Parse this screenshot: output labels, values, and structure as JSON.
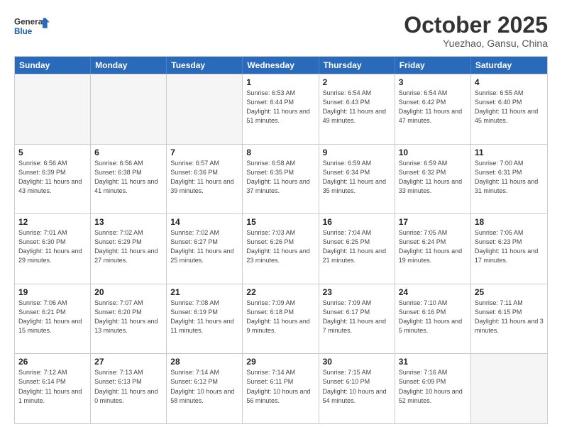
{
  "logo": {
    "line1": "General",
    "line2": "Blue"
  },
  "title": "October 2025",
  "subtitle": "Yuezhao, Gansu, China",
  "days_of_week": [
    "Sunday",
    "Monday",
    "Tuesday",
    "Wednesday",
    "Thursday",
    "Friday",
    "Saturday"
  ],
  "weeks": [
    [
      {
        "num": "",
        "info": ""
      },
      {
        "num": "",
        "info": ""
      },
      {
        "num": "",
        "info": ""
      },
      {
        "num": "1",
        "info": "Sunrise: 6:53 AM\nSunset: 6:44 PM\nDaylight: 11 hours\nand 51 minutes."
      },
      {
        "num": "2",
        "info": "Sunrise: 6:54 AM\nSunset: 6:43 PM\nDaylight: 11 hours\nand 49 minutes."
      },
      {
        "num": "3",
        "info": "Sunrise: 6:54 AM\nSunset: 6:42 PM\nDaylight: 11 hours\nand 47 minutes."
      },
      {
        "num": "4",
        "info": "Sunrise: 6:55 AM\nSunset: 6:40 PM\nDaylight: 11 hours\nand 45 minutes."
      }
    ],
    [
      {
        "num": "5",
        "info": "Sunrise: 6:56 AM\nSunset: 6:39 PM\nDaylight: 11 hours\nand 43 minutes."
      },
      {
        "num": "6",
        "info": "Sunrise: 6:56 AM\nSunset: 6:38 PM\nDaylight: 11 hours\nand 41 minutes."
      },
      {
        "num": "7",
        "info": "Sunrise: 6:57 AM\nSunset: 6:36 PM\nDaylight: 11 hours\nand 39 minutes."
      },
      {
        "num": "8",
        "info": "Sunrise: 6:58 AM\nSunset: 6:35 PM\nDaylight: 11 hours\nand 37 minutes."
      },
      {
        "num": "9",
        "info": "Sunrise: 6:59 AM\nSunset: 6:34 PM\nDaylight: 11 hours\nand 35 minutes."
      },
      {
        "num": "10",
        "info": "Sunrise: 6:59 AM\nSunset: 6:32 PM\nDaylight: 11 hours\nand 33 minutes."
      },
      {
        "num": "11",
        "info": "Sunrise: 7:00 AM\nSunset: 6:31 PM\nDaylight: 11 hours\nand 31 minutes."
      }
    ],
    [
      {
        "num": "12",
        "info": "Sunrise: 7:01 AM\nSunset: 6:30 PM\nDaylight: 11 hours\nand 29 minutes."
      },
      {
        "num": "13",
        "info": "Sunrise: 7:02 AM\nSunset: 6:29 PM\nDaylight: 11 hours\nand 27 minutes."
      },
      {
        "num": "14",
        "info": "Sunrise: 7:02 AM\nSunset: 6:27 PM\nDaylight: 11 hours\nand 25 minutes."
      },
      {
        "num": "15",
        "info": "Sunrise: 7:03 AM\nSunset: 6:26 PM\nDaylight: 11 hours\nand 23 minutes."
      },
      {
        "num": "16",
        "info": "Sunrise: 7:04 AM\nSunset: 6:25 PM\nDaylight: 11 hours\nand 21 minutes."
      },
      {
        "num": "17",
        "info": "Sunrise: 7:05 AM\nSunset: 6:24 PM\nDaylight: 11 hours\nand 19 minutes."
      },
      {
        "num": "18",
        "info": "Sunrise: 7:05 AM\nSunset: 6:23 PM\nDaylight: 11 hours\nand 17 minutes."
      }
    ],
    [
      {
        "num": "19",
        "info": "Sunrise: 7:06 AM\nSunset: 6:21 PM\nDaylight: 11 hours\nand 15 minutes."
      },
      {
        "num": "20",
        "info": "Sunrise: 7:07 AM\nSunset: 6:20 PM\nDaylight: 11 hours\nand 13 minutes."
      },
      {
        "num": "21",
        "info": "Sunrise: 7:08 AM\nSunset: 6:19 PM\nDaylight: 11 hours\nand 11 minutes."
      },
      {
        "num": "22",
        "info": "Sunrise: 7:09 AM\nSunset: 6:18 PM\nDaylight: 11 hours\nand 9 minutes."
      },
      {
        "num": "23",
        "info": "Sunrise: 7:09 AM\nSunset: 6:17 PM\nDaylight: 11 hours\nand 7 minutes."
      },
      {
        "num": "24",
        "info": "Sunrise: 7:10 AM\nSunset: 6:16 PM\nDaylight: 11 hours\nand 5 minutes."
      },
      {
        "num": "25",
        "info": "Sunrise: 7:11 AM\nSunset: 6:15 PM\nDaylight: 11 hours\nand 3 minutes."
      }
    ],
    [
      {
        "num": "26",
        "info": "Sunrise: 7:12 AM\nSunset: 6:14 PM\nDaylight: 11 hours\nand 1 minute."
      },
      {
        "num": "27",
        "info": "Sunrise: 7:13 AM\nSunset: 6:13 PM\nDaylight: 11 hours\nand 0 minutes."
      },
      {
        "num": "28",
        "info": "Sunrise: 7:14 AM\nSunset: 6:12 PM\nDaylight: 10 hours\nand 58 minutes."
      },
      {
        "num": "29",
        "info": "Sunrise: 7:14 AM\nSunset: 6:11 PM\nDaylight: 10 hours\nand 56 minutes."
      },
      {
        "num": "30",
        "info": "Sunrise: 7:15 AM\nSunset: 6:10 PM\nDaylight: 10 hours\nand 54 minutes."
      },
      {
        "num": "31",
        "info": "Sunrise: 7:16 AM\nSunset: 6:09 PM\nDaylight: 10 hours\nand 52 minutes."
      },
      {
        "num": "",
        "info": ""
      }
    ]
  ]
}
